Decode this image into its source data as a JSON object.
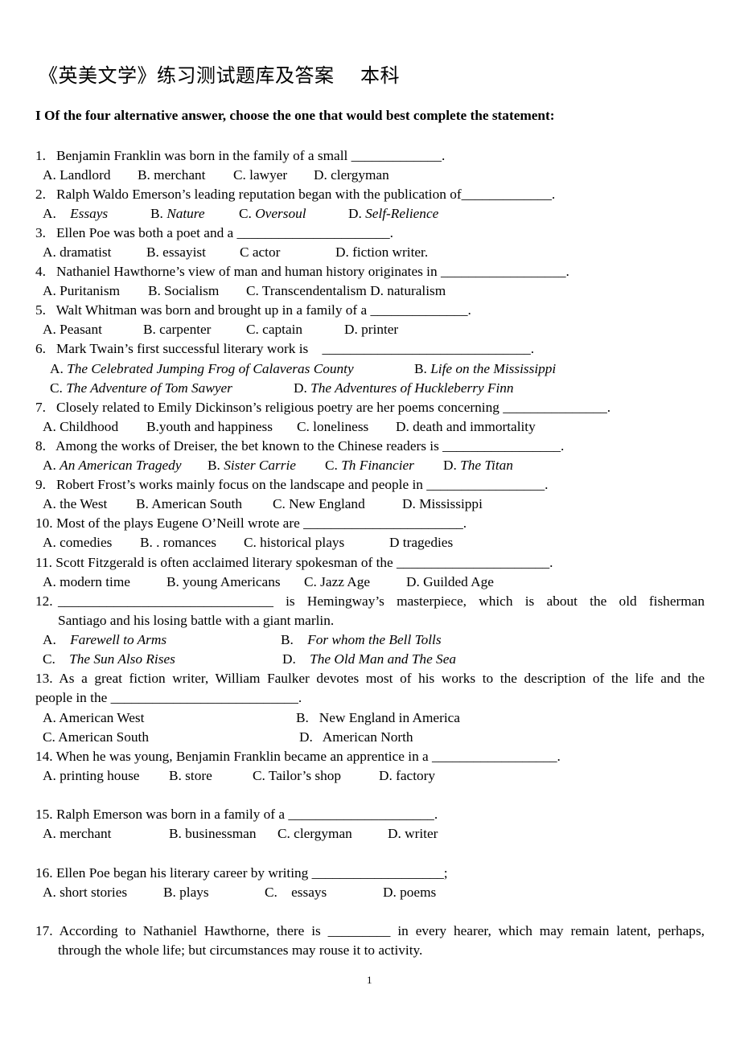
{
  "title": "《英美文学》练习测试题库及答案    本科",
  "instruction": "I Of the four alternative answer, choose the one that would best complete the statement:",
  "questions": [
    {
      "num": "1.",
      "stem": "Benjamin Franklin was born in the family of a small _____________.",
      "options": [
        {
          "label": "A. Landlord"
        },
        {
          "label": "B. merchant"
        },
        {
          "label": "C. lawyer"
        },
        {
          "label": "D. clergyman"
        }
      ]
    },
    {
      "num": "2.",
      "stem": "Ralph Waldo Emerson’s leading reputation began with the publication of_____________.",
      "options": [
        {
          "prefix": "A.",
          "text": "Essays"
        },
        {
          "prefix": "B.",
          "text": "Nature"
        },
        {
          "prefix": "C.",
          "text": "Oversoul"
        },
        {
          "prefix": "D.",
          "text": "Self-Relience"
        }
      ]
    },
    {
      "num": "3.",
      "stem": "Ellen Poe was both a poet and a ______________________.",
      "options": [
        {
          "label": "A. dramatist"
        },
        {
          "label": "B. essayist"
        },
        {
          "label": "C actor"
        },
        {
          "label": "D. fiction writer."
        }
      ]
    },
    {
      "num": "4.",
      "stem": "Nathaniel Hawthorne’s view of man and human history originates in __________________.",
      "options": [
        {
          "label": "A. Puritanism"
        },
        {
          "label": "B. Socialism"
        },
        {
          "label": "C. Transcendentalism D. naturalism"
        }
      ]
    },
    {
      "num": "5.",
      "stem": "Walt Whitman was born and brought up in a family of a ______________.",
      "options": [
        {
          "label": "A. Peasant"
        },
        {
          "label": "B. carpenter"
        },
        {
          "label": "C. captain"
        },
        {
          "label": "D. printer"
        }
      ]
    },
    {
      "num": "6.",
      "stem": "Mark Twain’s first successful literary work is    ______________________________.",
      "options": [
        {
          "prefix": "A.",
          "text": "The Celebrated Jumping Frog of Calaveras County"
        },
        {
          "prefix": "B.",
          "text": "Life on the Mississippi"
        },
        {
          "prefix": "C.",
          "text": "The Adventure of Tom Sawyer"
        },
        {
          "prefix": "D.",
          "text": "The Adventures of Huckleberry Finn"
        }
      ]
    },
    {
      "num": "7.",
      "stem": "Closely related to Emily Dickinson’s religious poetry are her poems concerning _______________.",
      "options": [
        {
          "label": "A. Childhood"
        },
        {
          "label": "B.youth and happiness"
        },
        {
          "label": "C. loneliness"
        },
        {
          "label": "D. death and immortality"
        }
      ]
    },
    {
      "num": "8.",
      "stem": "Among the works of Dreiser, the bet known to the Chinese readers is _________________.",
      "options": [
        {
          "prefix": "A.",
          "text": "An American Tragedy"
        },
        {
          "prefix": "B.",
          "text": "Sister Carrie"
        },
        {
          "prefix": "C.",
          "text": "Th Financier"
        },
        {
          "prefix": "D.",
          "text": "The Titan"
        }
      ]
    },
    {
      "num": "9.",
      "stem": "Robert Frost’s works mainly focus on the landscape and people in _________________.",
      "options": [
        {
          "label": "A. the West"
        },
        {
          "label": "B. American South"
        },
        {
          "label": "C. New England"
        },
        {
          "label": "D. Mississippi"
        }
      ]
    },
    {
      "num": "10.",
      "stem": "Most of the plays Eugene O’Neill wrote are _______________________.",
      "options": [
        {
          "label": "A. comedies"
        },
        {
          "label": "B. . romances"
        },
        {
          "label": "C. historical plays"
        },
        {
          "label": "D tragedies"
        }
      ]
    },
    {
      "num": "11.",
      "stem": "Scott Fitzgerald is often acclaimed literary spokesman of the ______________________.",
      "options": [
        {
          "label": "A. modern time"
        },
        {
          "label": "B. young Americans"
        },
        {
          "label": "C. Jazz Age"
        },
        {
          "label": "D. Guilded Age"
        }
      ]
    },
    {
      "num": "12.",
      "stem": "_______________________________ is Hemingway’s masterpiece, which is about the old    fisherman",
      "stem_cont": "Santiago and his losing battle with a giant marlin.",
      "options": [
        {
          "prefix": "A.",
          "text": "Farewell to Arms"
        },
        {
          "prefix": "B.",
          "text": "For whom the Bell Tolls"
        },
        {
          "prefix": "C.",
          "text": "The Sun Also Rises"
        },
        {
          "prefix": "D.",
          "text": "The Old Man and The Sea"
        }
      ]
    },
    {
      "num": "13.",
      "stem": "As a great fiction writer, William Faulker devotes most of his works to the description of the life and the",
      "stem_cont": "people in the ___________________________.",
      "options": [
        {
          "label": "A. American West"
        },
        {
          "label": "B.   New England in America"
        },
        {
          "label": "C. American South"
        },
        {
          "label": "D.   American North"
        }
      ]
    },
    {
      "num": "14.",
      "stem": "When he was young, Benjamin Franklin became an apprentice in a __________________.",
      "options": [
        {
          "label": "A. printing house"
        },
        {
          "label": "B. store"
        },
        {
          "label": "C. Tailor’s shop"
        },
        {
          "label": "D. factory"
        }
      ]
    },
    {
      "num": "15.",
      "stem": "Ralph Emerson was born in a family of a _____________________.",
      "options": [
        {
          "label": "A. merchant"
        },
        {
          "label": "B. businessman"
        },
        {
          "label": "C. clergyman"
        },
        {
          "label": "D. writer"
        }
      ]
    },
    {
      "num": "16.",
      "stem": "Ellen Poe began his literary career by writing ___________________;",
      "options": [
        {
          "label": "A. short stories"
        },
        {
          "label": "B. plays"
        },
        {
          "label": "C.    essays"
        },
        {
          "label": "D. poems"
        }
      ]
    },
    {
      "num": "17.",
      "stem": "According to Nathaniel Hawthorne, there is _________ in every hearer, which may remain latent, perhaps,",
      "stem_cont": "through the whole life; but circumstances may rouse it to activity."
    }
  ],
  "page_number": "1"
}
